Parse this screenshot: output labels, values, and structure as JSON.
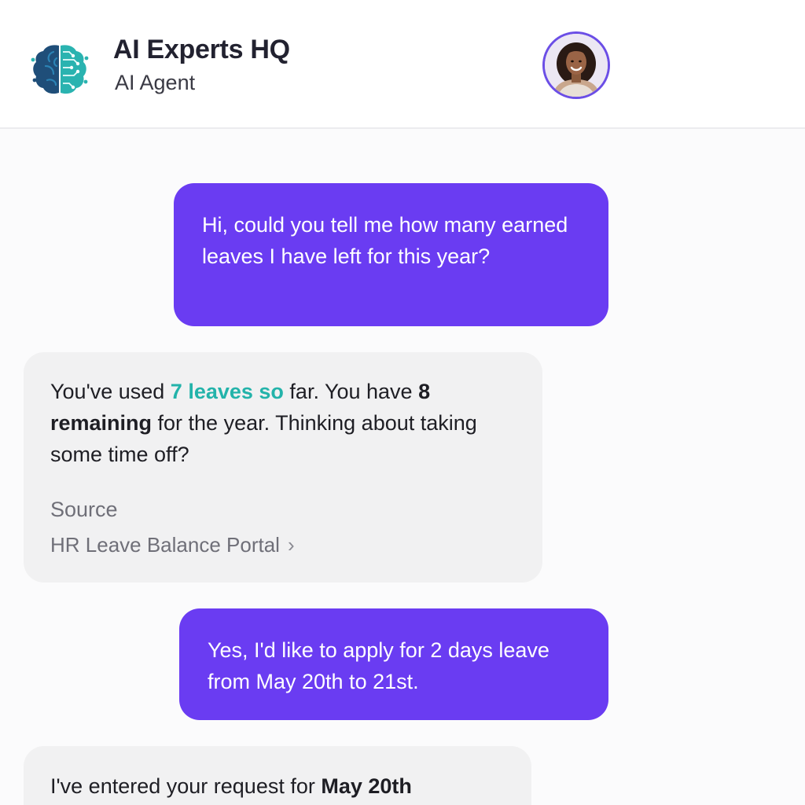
{
  "header": {
    "title": "AI Experts HQ",
    "subtitle": "AI Agent",
    "logo_icon": "brain-circuit-icon",
    "avatar_icon": "user-avatar"
  },
  "colors": {
    "accent": "#6a3cf2",
    "highlight": "#23b3aa",
    "bot_bubble": "#f1f1f2"
  },
  "messages": [
    {
      "role": "user",
      "text": "Hi, could you tell me how many earned leaves I have left for this year?"
    },
    {
      "role": "assistant",
      "text_parts": {
        "a": "You've used ",
        "b": "7 leaves so",
        "c": " far. You have ",
        "d": "8 remaining",
        "e": " for the year. Thinking about taking some time off?"
      },
      "source_label": "Source",
      "source_link": "HR Leave Balance Portal",
      "source_chevron": "›"
    },
    {
      "role": "user",
      "text": "Yes, I'd like to apply for 2 days leave from May 20th to 21st."
    },
    {
      "role": "assistant",
      "text_parts": {
        "a": "I've entered your request for ",
        "b": "May 20th"
      }
    }
  ]
}
